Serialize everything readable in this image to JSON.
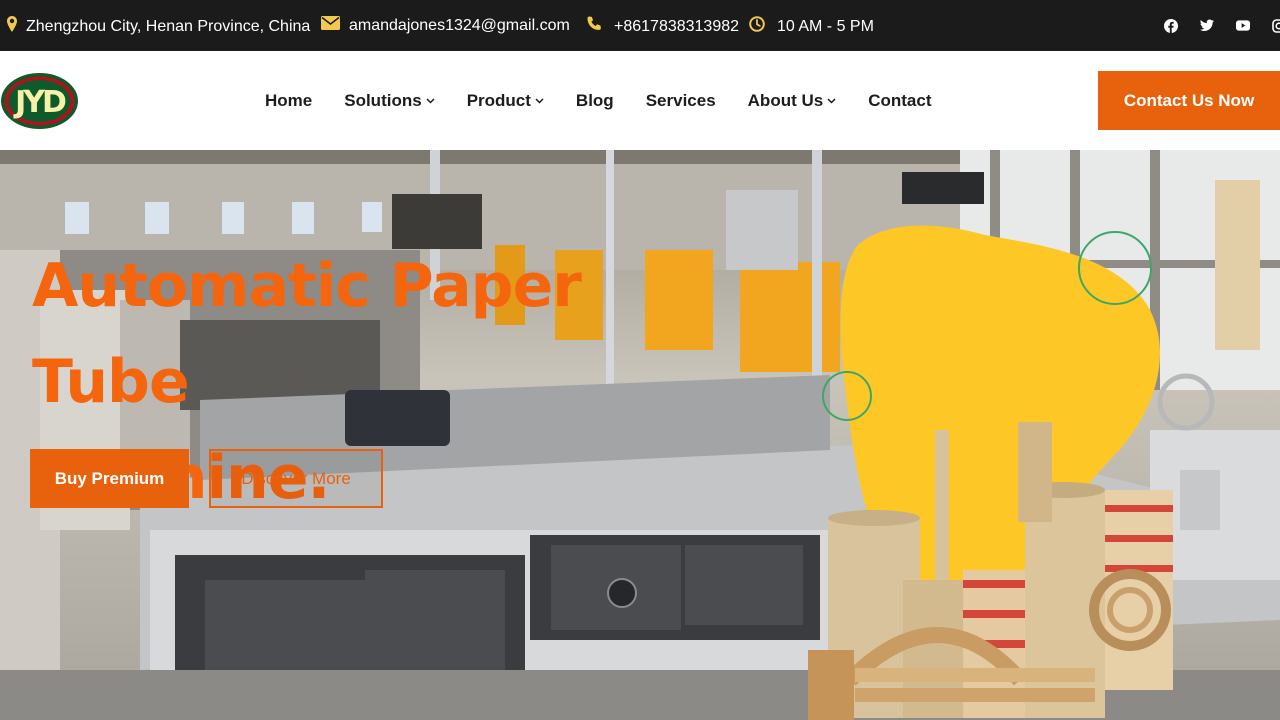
{
  "topbar": {
    "location": "Zhengzhou City, Henan Province, China",
    "email": "amandajones1324@gmail.com",
    "phone": "+8617838313982",
    "hours": "10 AM - 5 PM",
    "socials": [
      "facebook-icon",
      "twitter-icon",
      "youtube-icon",
      "instagram-icon"
    ]
  },
  "header": {
    "logo_text": "JYD",
    "nav": [
      {
        "label": "Home",
        "has_dropdown": false
      },
      {
        "label": "Solutions",
        "has_dropdown": true
      },
      {
        "label": "Product",
        "has_dropdown": true
      },
      {
        "label": "Blog",
        "has_dropdown": false
      },
      {
        "label": "Services",
        "has_dropdown": false
      },
      {
        "label": "About Us",
        "has_dropdown": true
      },
      {
        "label": "Contact",
        "has_dropdown": false
      }
    ],
    "cta_label": "Contact Us Now"
  },
  "hero": {
    "title_line1": "Automatic Paper Tube",
    "title_line2": "Machine.",
    "primary_label": "Buy Premium",
    "secondary_label": "Discover More"
  },
  "colors": {
    "accent": "#e8620e",
    "topbar_bg": "#1b1b1b",
    "icon_yellow": "#f2c94c",
    "blob_yellow": "#fdc825",
    "ring_green": "#3fa66a",
    "logo_green": "#0f5a2b",
    "logo_red": "#b0121d"
  }
}
